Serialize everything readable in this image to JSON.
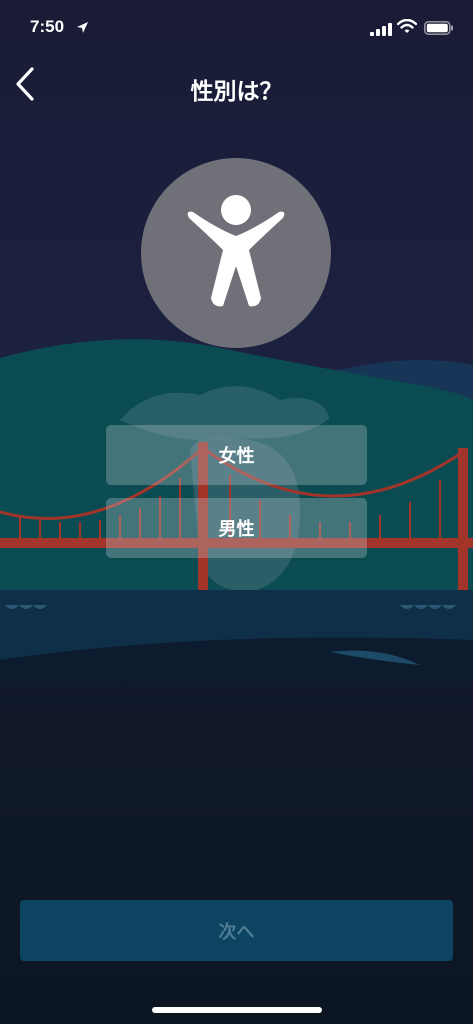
{
  "status_bar": {
    "time": "7:50",
    "icons": [
      "location-arrow-icon",
      "cellular-signal-icon",
      "wifi-icon",
      "battery-icon"
    ]
  },
  "header": {
    "back_icon": "chevron-left-icon",
    "title": "性別は？"
  },
  "avatar": {
    "icon": "person-arms-raised-icon"
  },
  "options": {
    "female_label": "女性",
    "male_label": "男性"
  },
  "footer": {
    "next_label": "次へ",
    "next_enabled": false
  },
  "colors": {
    "background_top": "#1a1c36",
    "avatar_circle": "#6f7078",
    "bridge": "#a3342a",
    "hill": "#0b4c52",
    "next_button_bg": "#0d4462",
    "next_button_text": "#4f7c93"
  }
}
